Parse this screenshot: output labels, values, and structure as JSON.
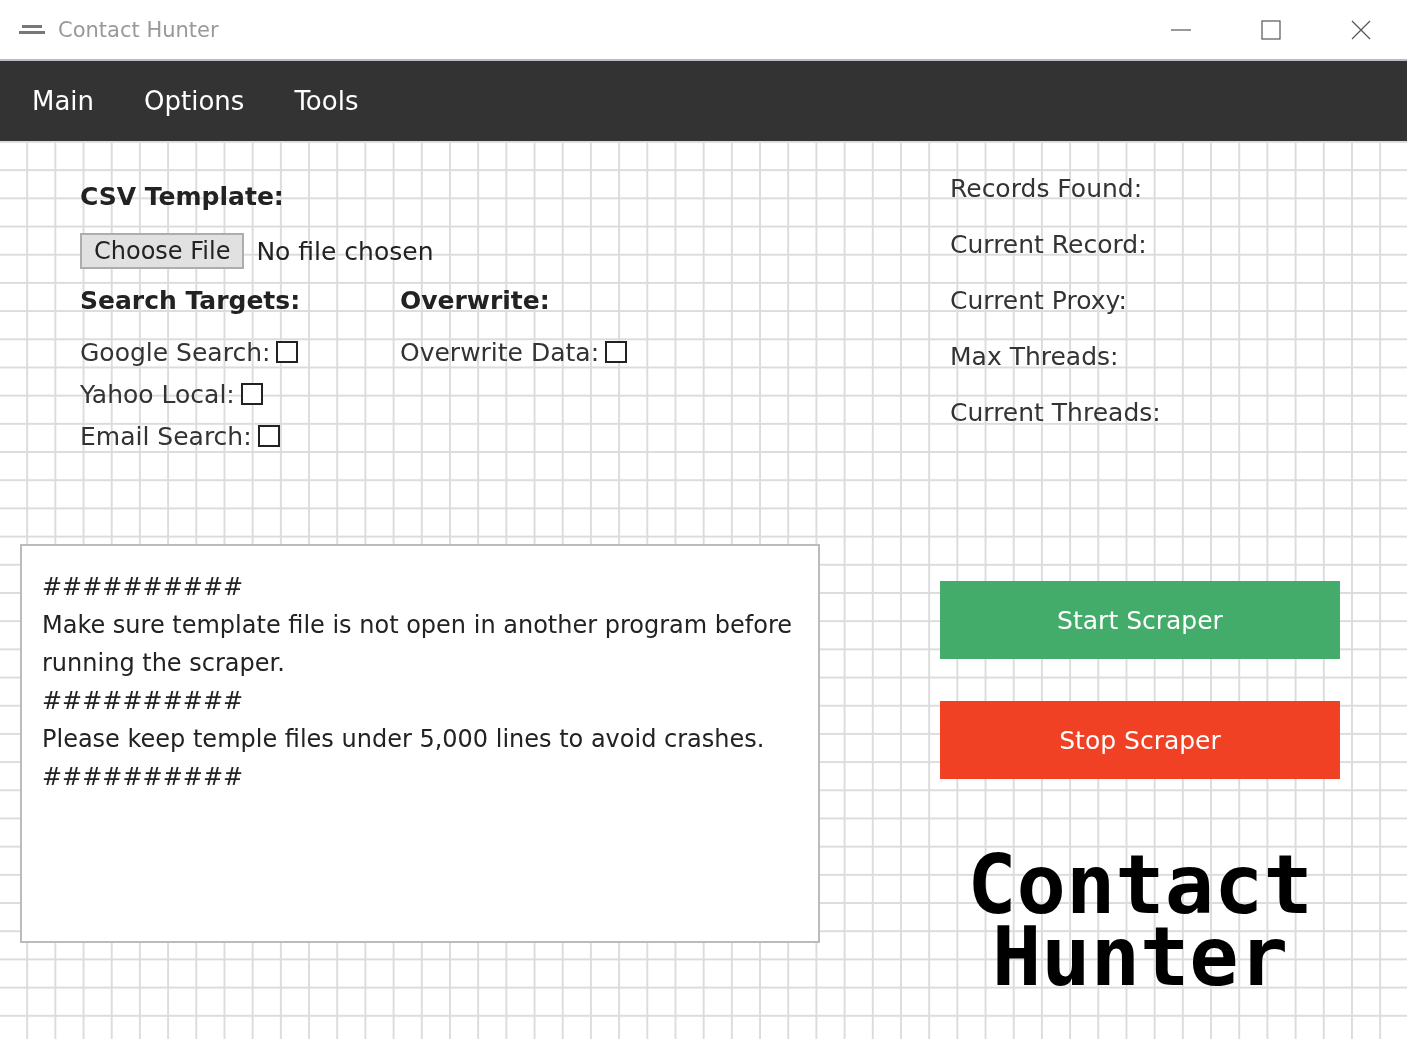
{
  "window": {
    "title": "Contact Hunter"
  },
  "menu": [
    {
      "label": "Main"
    },
    {
      "label": "Options"
    },
    {
      "label": "Tools"
    }
  ],
  "csv_template": {
    "heading": "CSV Template:",
    "button": "Choose File",
    "file_status": "No file chosen"
  },
  "search_targets": {
    "heading": "Search Targets:",
    "options": [
      {
        "label": "Google Search:",
        "checked": false
      },
      {
        "label": "Yahoo Local:",
        "checked": false
      },
      {
        "label": "Email Search:",
        "checked": false
      }
    ]
  },
  "overwrite": {
    "heading": "Overwrite:",
    "options": [
      {
        "label": "Overwrite Data:",
        "checked": false
      }
    ]
  },
  "log": [
    "##########",
    "Make sure template file is not open in another program before running the scraper.",
    "##########",
    "Please keep temple files under 5,000 lines to avoid crashes.",
    "##########"
  ],
  "stats": [
    "Records Found:",
    "Current Record:",
    "Current Proxy:",
    "Max Threads:",
    "Current Threads:"
  ],
  "buttons": [
    {
      "label": "Start Scraper",
      "kind": "start"
    },
    {
      "label": "Stop Scraper",
      "kind": "stop"
    }
  ],
  "logo": {
    "lines": [
      "Contact",
      "Hunter"
    ]
  }
}
